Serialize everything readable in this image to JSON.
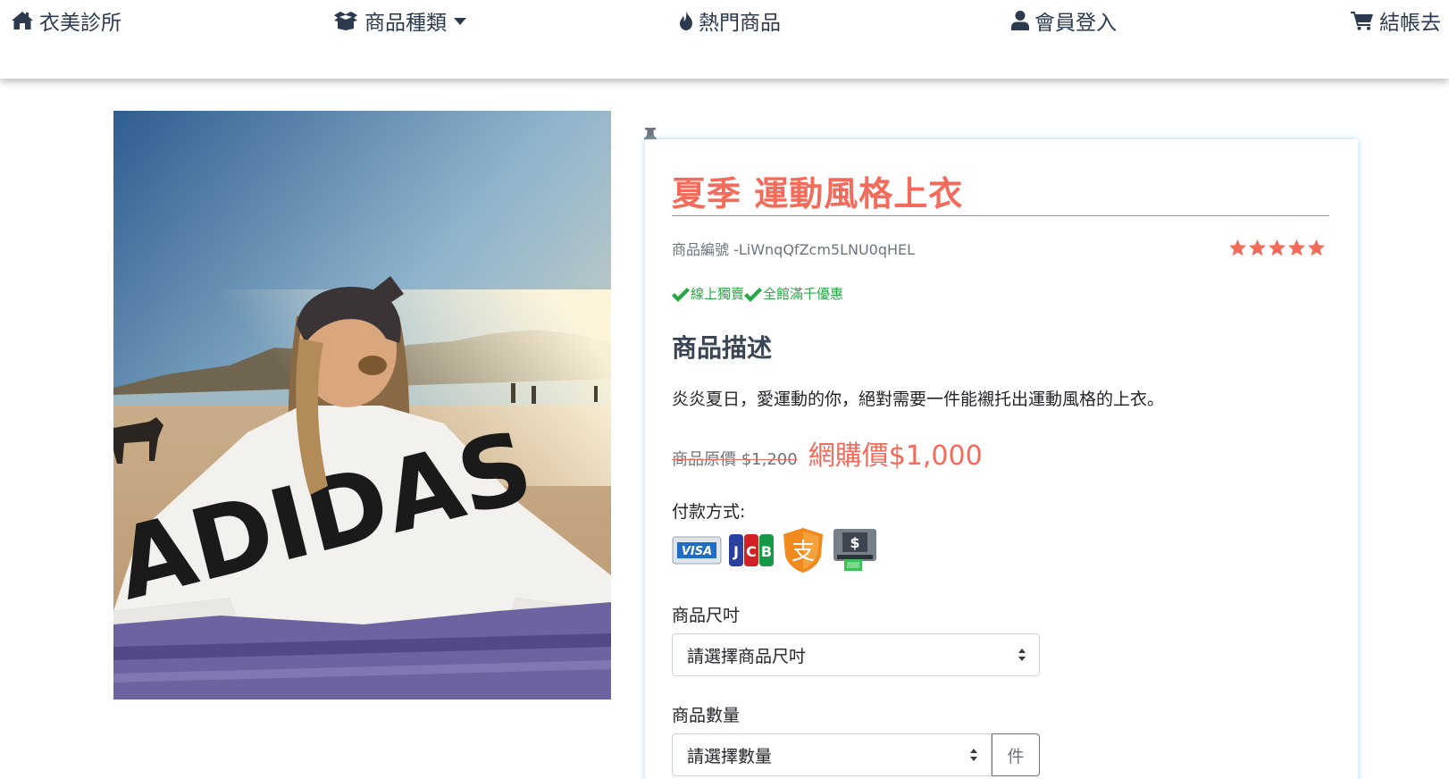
{
  "nav": {
    "home": {
      "label": "衣美診所",
      "icon": "home-icon"
    },
    "category": {
      "label": "商品種類",
      "icon": "box-open-icon"
    },
    "hot": {
      "label": "熱門商品",
      "icon": "fire-icon"
    },
    "member": {
      "label": "會員登入",
      "icon": "user-icon"
    },
    "checkout": {
      "label": "結帳去",
      "icon": "shopping-cart-icon"
    }
  },
  "product": {
    "title": "夏季 運動風格上衣",
    "sku": "商品編號 -LiWnqQfZcm5LNU0qHEL",
    "rating": 5,
    "rating_max": 5,
    "features": [
      "線上獨賣",
      "全館滿千優惠"
    ],
    "description_heading": "商品描述",
    "description": "炎炎夏日，愛運動的你，絕對需要一件能襯托出運動風格的上衣。",
    "original_price": "商品原價 $1,200",
    "sale_price": "網購價$1,000",
    "shirt_print": "ADIDAS"
  },
  "payment": {
    "label": "付款方式:",
    "methods": [
      {
        "name": "VISA",
        "icon": "visa-card-icon"
      },
      {
        "name": "JCB",
        "icon": "jcb-card-icon"
      },
      {
        "name": "支",
        "icon": "alipay-icon"
      },
      {
        "name": "$",
        "icon": "atm-icon"
      }
    ]
  },
  "size": {
    "label": "商品尺吋",
    "selected": "請選擇商品尺吋"
  },
  "quantity": {
    "label": "商品數量",
    "selected": "請選擇數量",
    "unit": "件"
  },
  "colors": {
    "accent": "#f36b5a",
    "nav_text": "#2b3a4f",
    "feature_green": "#28a745"
  }
}
